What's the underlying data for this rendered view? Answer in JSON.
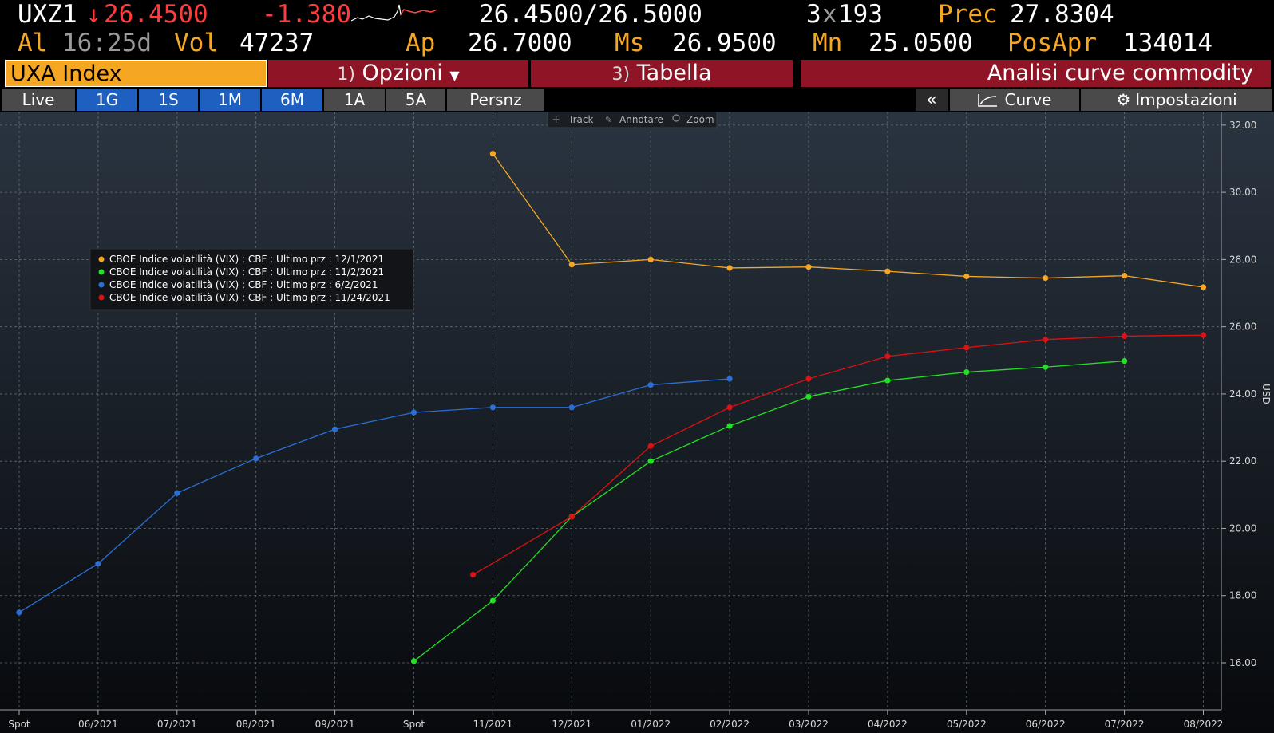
{
  "header": {
    "ticker": "UXZ1",
    "arrow": "↓",
    "last": "26.4500",
    "change": "-1.380",
    "bid_ask": "26.4500/26.5000",
    "size_num": "3",
    "size_x": "x",
    "size_den": "193",
    "prev_label": "Prec",
    "prev_value": "27.8304",
    "at_label": "Al",
    "time": "16:25d",
    "vol_label": "Vol",
    "vol_value": "47237",
    "open_label": "Ap",
    "open_value": "26.7000",
    "high_label": "Ms",
    "high_value": "26.9500",
    "low_label": "Mn",
    "low_value": "25.0500",
    "oi_label": "PosApr",
    "oi_value": "134014"
  },
  "tabs": {
    "security": "UXA Index",
    "options_num": "1)",
    "options_label": "Opzioni",
    "table_num": "3)",
    "table_label": "Tabella",
    "title": "Analisi curve commodity"
  },
  "periods": [
    "Live",
    "1G",
    "1S",
    "1M",
    "6M",
    "1A",
    "5A",
    "Persnz"
  ],
  "toolbar": {
    "collapse": "«",
    "curves": "Curve",
    "settings": "Impostazioni",
    "track": "Track",
    "annotate": "Annotare",
    "zoom": "Zoom"
  },
  "colors": {
    "orange": "#f5a623",
    "red_text": "#ff3b3b",
    "tab_red": "#8e1426",
    "series_orange": "#f5a623",
    "series_green": "#22e022",
    "series_blue": "#2a6fd6",
    "series_red": "#dd1111"
  },
  "chart_data": {
    "type": "line",
    "x_ticks": [
      "Spot",
      "06/2021",
      "07/2021",
      "08/2021",
      "09/2021",
      "Spot",
      "11/2021",
      "12/2021",
      "01/2022",
      "02/2022",
      "03/2022",
      "04/2022",
      "05/2022",
      "06/2022",
      "07/2022",
      "08/2022"
    ],
    "y_ticks": [
      "32.00",
      "30.00",
      "28.00",
      "26.00",
      "24.00",
      "22.00",
      "20.00",
      "18.00",
      "16.00"
    ],
    "ylim": [
      14.6,
      32.4
    ],
    "ylabel": "USD",
    "grid": true,
    "legend_position": "top-left",
    "series": [
      {
        "name": "CBOE Indice volatilità (VIX) : CBF : Ultimo prz : 12/1/2021",
        "color": "#f5a623",
        "x": [
          6,
          7,
          8,
          9,
          10,
          11,
          12,
          13,
          14,
          15
        ],
        "values": [
          31.15,
          27.85,
          28.0,
          27.75,
          27.78,
          27.65,
          27.5,
          27.45,
          27.52,
          27.18
        ]
      },
      {
        "name": "CBOE Indice volatilità (VIX) : CBF : Ultimo prz : 11/2/2021",
        "color": "#22e022",
        "x": [
          5,
          6,
          7,
          8,
          9,
          10,
          11,
          12,
          13,
          14
        ],
        "values": [
          16.05,
          17.85,
          20.35,
          22.0,
          23.05,
          23.92,
          24.4,
          24.65,
          24.8,
          24.98
        ]
      },
      {
        "name": "CBOE Indice volatilità (VIX) : CBF : Ultimo prz : 6/2/2021",
        "color": "#2a6fd6",
        "x": [
          0,
          1,
          2,
          3,
          4,
          5,
          6,
          7,
          8,
          9
        ],
        "values": [
          17.5,
          18.95,
          21.05,
          22.08,
          22.95,
          23.45,
          23.6,
          23.6,
          24.27,
          24.45
        ]
      },
      {
        "name": "CBOE Indice volatilità (VIX) : CBF : Ultimo prz : 11/24/2021",
        "color": "#dd1111",
        "x": [
          5.75,
          7,
          8,
          9,
          10,
          11,
          12,
          13,
          14,
          15
        ],
        "values": [
          18.62,
          20.35,
          22.45,
          23.6,
          24.45,
          25.12,
          25.38,
          25.62,
          25.72,
          25.75
        ]
      }
    ]
  }
}
